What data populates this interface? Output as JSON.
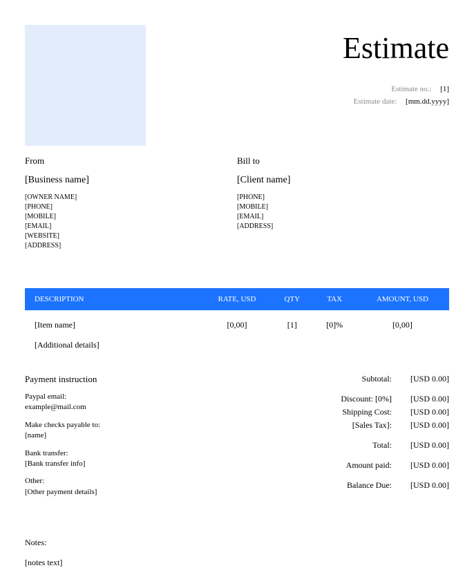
{
  "title": "Estimate",
  "meta": {
    "estimate_no_label": "Estimate no.:",
    "estimate_no_value": "[1]",
    "estimate_date_label": "Estimate date:",
    "estimate_date_value": "[mm.dd.yyyy]"
  },
  "from": {
    "heading": "From",
    "name": "[Business name]",
    "owner": "[OWNER NAME]",
    "phone": "[PHONE]",
    "mobile": "[MOBILE]",
    "email": "[EMAIL]",
    "website": "[WEBSITE]",
    "address": "[ADDRESS]"
  },
  "billto": {
    "heading": "Bill to",
    "name": "[Client name]",
    "phone": "[PHONE]",
    "mobile": "[MOBILE]",
    "email": "[EMAIL]",
    "address": "[ADDRESS]"
  },
  "table": {
    "headers": {
      "description": "DESCRIPTION",
      "rate": "RATE, USD",
      "qty": "QTY",
      "tax": "TAX",
      "amount": "AMOUNT, USD"
    },
    "row": {
      "item": "[Item name]",
      "rate": "[0,00]",
      "qty": "[1]",
      "tax": "[0]%",
      "amount": "[0,00]"
    },
    "additional": "[Additional details]"
  },
  "payment": {
    "heading": "Payment instruction",
    "paypal_label": "Paypal email:",
    "paypal_value": "example@mail.com",
    "checks_label": "Make checks payable to:",
    "checks_value": "[name]",
    "bank_label": "Bank transfer:",
    "bank_value": "[Bank transfer info]",
    "other_label": "Other:",
    "other_value": "[Other payment details]"
  },
  "totals": {
    "subtotal_label": "Subtotal:",
    "subtotal_value": "[USD 0.00]",
    "discount_label": "Discount: [0%]",
    "discount_value": "[USD 0.00]",
    "shipping_label": "Shipping Cost:",
    "shipping_value": "[USD 0.00]",
    "salestax_label": "[Sales Tax]:",
    "salestax_value": "[USD 0.00]",
    "total_label": "Total:",
    "total_value": "[USD 0.00]",
    "paid_label": "Amount paid:",
    "paid_value": "[USD 0.00]",
    "balance_label": "Balance Due:",
    "balance_value": "[USD 0.00]"
  },
  "notes": {
    "heading": "Notes:",
    "text": "[notes text]"
  }
}
